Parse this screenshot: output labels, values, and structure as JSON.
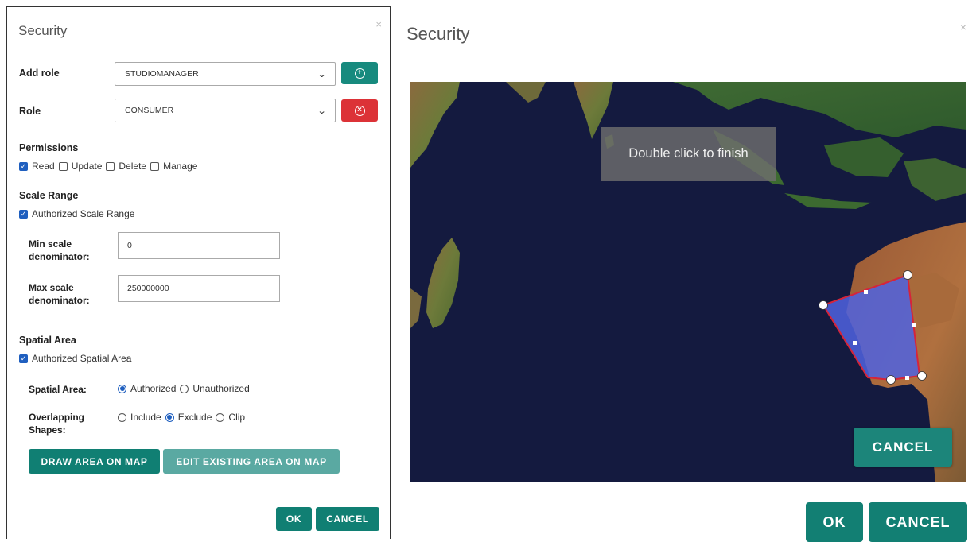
{
  "left_dialog": {
    "title": "Security",
    "close_glyph": "×",
    "add_role": {
      "label": "Add role",
      "value": "STUDIOMANAGER",
      "add_icon": "plus-circle-icon"
    },
    "role": {
      "label": "Role",
      "value": "CONSUMER",
      "remove_icon": "x-circle-icon"
    },
    "permissions": {
      "title": "Permissions",
      "items": [
        {
          "label": "Read",
          "checked": true
        },
        {
          "label": "Update",
          "checked": false
        },
        {
          "label": "Delete",
          "checked": false
        },
        {
          "label": "Manage",
          "checked": false
        }
      ]
    },
    "scale_range": {
      "title": "Scale Range",
      "checkbox_label": "Authorized Scale Range",
      "min_label_1": "Min scale",
      "min_label_2": "denominator:",
      "min_value": "0",
      "max_label_1": "Max scale",
      "max_label_2": "denominator:",
      "max_value": "250000000"
    },
    "spatial_area": {
      "title": "Spatial Area",
      "checkbox_label": "Authorized Spatial Area",
      "area_label": "Spatial Area:",
      "area_options": [
        {
          "label": "Authorized",
          "selected": true
        },
        {
          "label": "Unauthorized",
          "selected": false
        }
      ],
      "overlap_label_1": "Overlapping",
      "overlap_label_2": "Shapes:",
      "overlap_options": [
        {
          "label": "Include",
          "selected": false
        },
        {
          "label": "Exclude",
          "selected": true
        },
        {
          "label": "Clip",
          "selected": false
        }
      ]
    },
    "draw_button": "DRAW AREA ON MAP",
    "edit_button": "EDIT EXISTING AREA ON MAP",
    "ok_button": "OK",
    "cancel_button": "CANCEL"
  },
  "right_dialog": {
    "title": "Security",
    "close_glyph": "×",
    "map_tooltip": "Double click to finish",
    "map_cancel_button": "CANCEL",
    "ok_button": "OK",
    "cancel_button": "CANCEL"
  },
  "colors": {
    "teal": "#107f73",
    "teal_light": "#5aa9a2",
    "danger": "#dc3237",
    "polygon_fill": "#4f63e0",
    "polygon_stroke": "#d6243a",
    "ocean": "#141a3f"
  }
}
